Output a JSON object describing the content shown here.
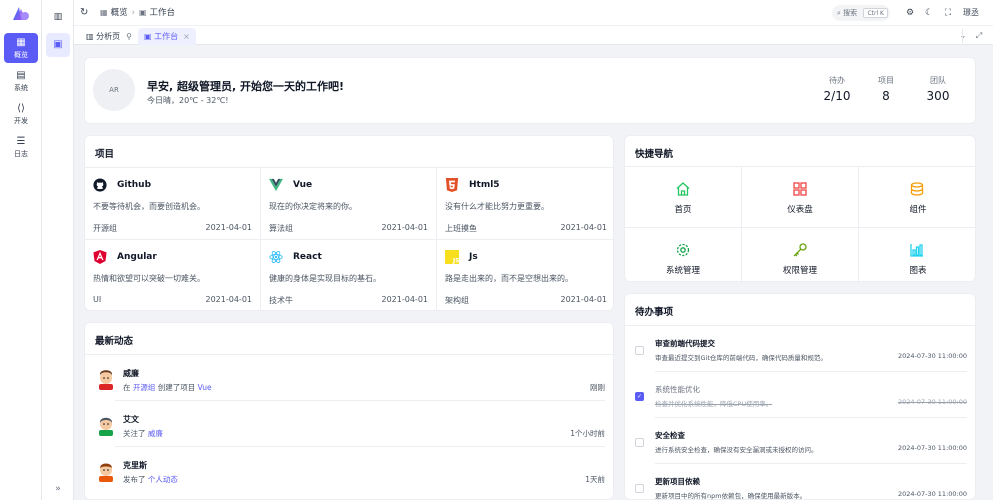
{
  "rail": {
    "items": [
      {
        "label": "概览",
        "icon": "dashboard-icon",
        "active": true
      },
      {
        "label": "系统",
        "icon": "server-icon"
      },
      {
        "label": "开发",
        "icon": "code-icon"
      },
      {
        "label": "日志",
        "icon": "list-icon"
      }
    ]
  },
  "header": {
    "breadcrumbs": [
      {
        "label": "概览",
        "icon": "grid-icon"
      },
      {
        "label": "工作台",
        "icon": "workbench-icon"
      }
    ],
    "search_label": "搜索",
    "search_kbd": "Ctrl K",
    "user": "璟丞"
  },
  "tabs": {
    "items": [
      {
        "label": "分析页",
        "icon": "bar-chart-icon",
        "pinned": true
      },
      {
        "label": "工作台",
        "icon": "workbench-icon",
        "active": true,
        "closable": true
      }
    ]
  },
  "welcome": {
    "avatar_text": "AR",
    "greeting": "早安, 超级管理员, 开始您一天的工作吧!",
    "weather": "今日晴，20℃ - 32℃!",
    "stats": [
      {
        "label": "待办",
        "value": "2/10"
      },
      {
        "label": "项目",
        "value": "8"
      },
      {
        "label": "团队",
        "value": "300"
      }
    ]
  },
  "projects": {
    "title": "项目",
    "items": [
      {
        "name": "Github",
        "desc": "不要等待机会，而要创造机会。",
        "group": "开源组",
        "date": "2021-04-01",
        "icon": "github-icon",
        "color": "#111827"
      },
      {
        "name": "Vue",
        "desc": "现在的你决定将来的你。",
        "group": "算法组",
        "date": "2021-04-01",
        "icon": "vue-icon",
        "color": "#41b883"
      },
      {
        "name": "Html5",
        "desc": "没有什么才能比努力更重要。",
        "group": "上班摸鱼",
        "date": "2021-04-01",
        "icon": "html5-icon",
        "color": "#e34f26"
      },
      {
        "name": "Angular",
        "desc": "热情和欲望可以突破一切难关。",
        "group": "UI",
        "date": "2021-04-01",
        "icon": "angular-icon",
        "color": "#dd0031"
      },
      {
        "name": "React",
        "desc": "健康的身体是实现目标的基石。",
        "group": "技术牛",
        "date": "2021-04-01",
        "icon": "react-icon",
        "color": "#38bdf8"
      },
      {
        "name": "Js",
        "desc": "路是走出来的，而不是空想出来的。",
        "group": "架构组",
        "date": "2021-04-01",
        "icon": "js-icon",
        "color": "#f7df1e"
      }
    ]
  },
  "quick_nav": {
    "title": "快捷导航",
    "items": [
      {
        "label": "首页",
        "icon": "home-icon",
        "color": "#22c55e"
      },
      {
        "label": "仪表盘",
        "icon": "dashboard-icon",
        "color": "#ef4444"
      },
      {
        "label": "组件",
        "icon": "layers-icon",
        "color": "#f59e0b"
      },
      {
        "label": "系统管理",
        "icon": "gear-icon",
        "color": "#16a34a"
      },
      {
        "label": "权限管理",
        "icon": "key-icon",
        "color": "#65a30d"
      },
      {
        "label": "图表",
        "icon": "chart-icon",
        "color": "#22d3ee"
      }
    ]
  },
  "activity": {
    "title": "最新动态",
    "items": [
      {
        "name": "威廉",
        "prefix": "在 ",
        "link": "开源组",
        "middle": " 创建了项目 ",
        "link2": "Vue",
        "time": "刚刚",
        "shirt": "#dc2626"
      },
      {
        "name": "艾文",
        "prefix": "关注了 ",
        "link": "威廉",
        "middle": "",
        "link2": "",
        "time": "1个小时前",
        "shirt": "#16a34a"
      },
      {
        "name": "克里斯",
        "prefix": "发布了 ",
        "link": "个人动态",
        "middle": "",
        "link2": "",
        "time": "1天前",
        "shirt": "#ea580c"
      }
    ]
  },
  "todo": {
    "title": "待办事项",
    "items": [
      {
        "title": "审查前端代码提交",
        "desc": "审查最近提交到Git仓库的前端代码，确保代码质量和规范。",
        "time": "2024-07-30 11:00:00",
        "done": false
      },
      {
        "title": "系统性能优化",
        "desc": "检查并优化系统性能，降低CPU使用率。",
        "time": "2024-07-30 11:00:00",
        "done": true
      },
      {
        "title": "安全检查",
        "desc": "进行系统安全检查，确保没有安全漏洞或未授权的访问。",
        "time": "2024-07-30 11:00:00",
        "done": false
      },
      {
        "title": "更新项目依赖",
        "desc": "更新项目中的所有npm依赖包，确保使用最新版本。",
        "time": "2024-07-30 11:00:00",
        "done": false
      }
    ]
  }
}
